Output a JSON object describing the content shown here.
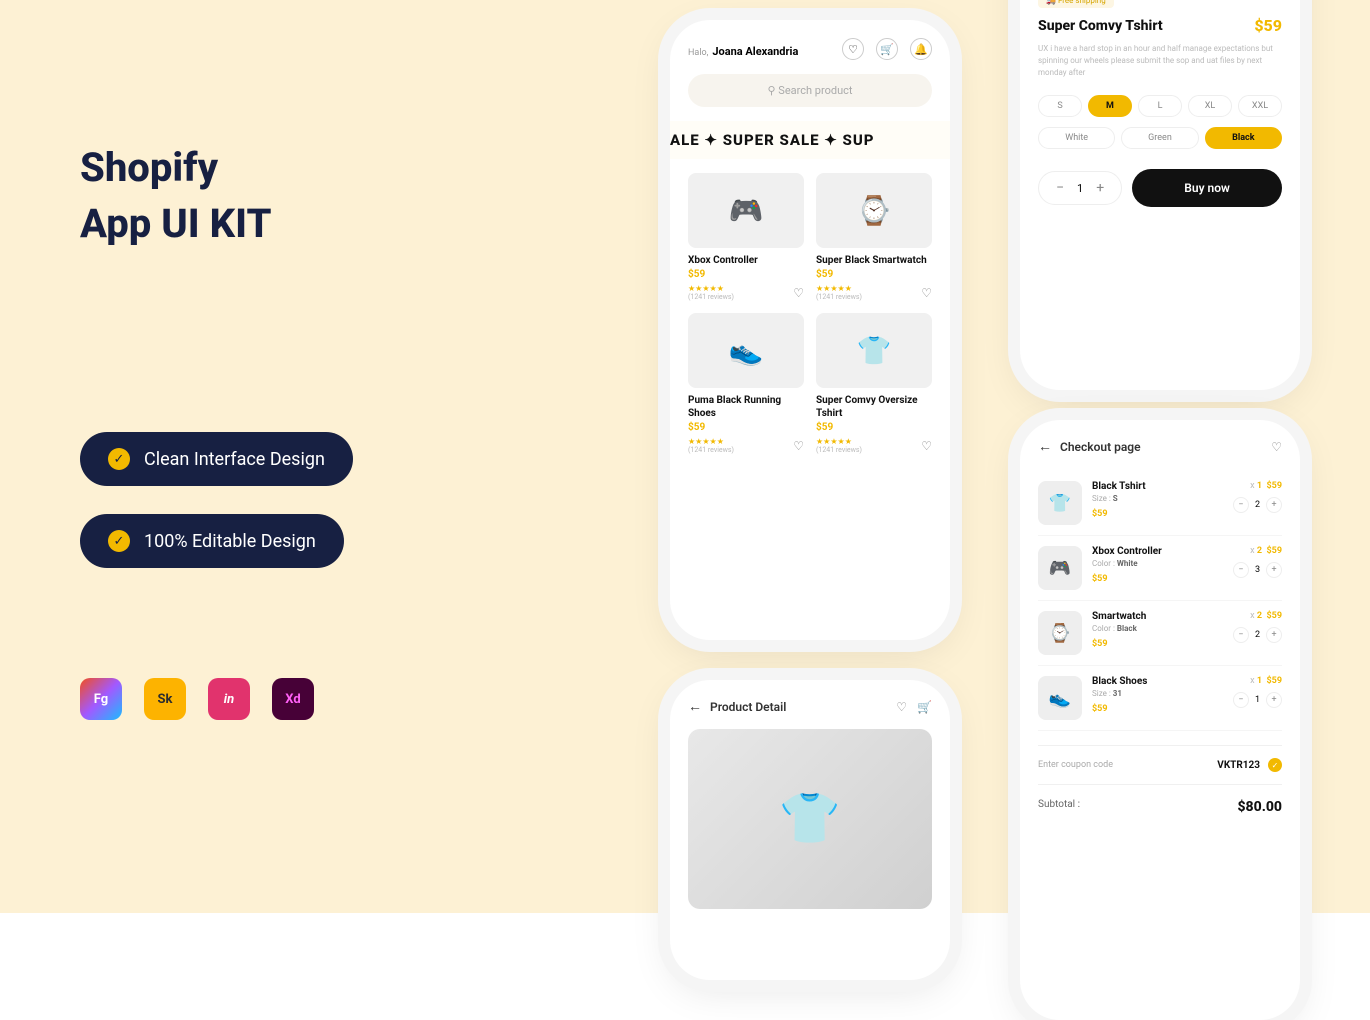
{
  "hero": {
    "title_line1": "Shopify",
    "title_line2": "App UI KIT"
  },
  "badges": [
    {
      "label": "Clean Interface Design"
    },
    {
      "label": "100% Editable Design"
    }
  ],
  "tools": [
    "Fg",
    "Sk",
    "in",
    "Xd"
  ],
  "home": {
    "greeting_prefix": "Halo,",
    "greeting_name": "Joana Alexandria",
    "search_placeholder": "Search product",
    "banner": "ALE ✦ SUPER SALE ✦ SUP",
    "products": [
      {
        "name": "Xbox Controller",
        "price": "$59",
        "reviews": "(1241 reviews)",
        "emoji": "🎮"
      },
      {
        "name": "Super Black Smartwatch",
        "price": "$59",
        "reviews": "(1241 reviews)",
        "emoji": "⌚"
      },
      {
        "name": "Puma Black Running Shoes",
        "price": "$59",
        "reviews": "(1241 reviews)",
        "emoji": "👟"
      },
      {
        "name": "Super Comvy Oversize Tshirt",
        "price": "$59",
        "reviews": "(1241 reviews)",
        "emoji": "👕"
      }
    ],
    "stars": "★★★★★"
  },
  "detail": {
    "free_ship": "Free shipping",
    "title": "Super Comvy Tshirt",
    "price": "$59",
    "desc": "UX i have a hard stop in an hour and half manage expectations but spinning our wheels please submit the sop and uat files by next monday after",
    "sizes": [
      "S",
      "M",
      "L",
      "XL",
      "XXL"
    ],
    "size_active": "M",
    "colors": [
      "White",
      "Green",
      "Black"
    ],
    "color_active": "Black",
    "qty": "1",
    "buy": "Buy now"
  },
  "checkout": {
    "title": "Checkout page",
    "items": [
      {
        "name": "Black Tshirt",
        "attr_label": "Size :",
        "attr_val": "S",
        "price": "$59",
        "qty": "1",
        "line_price": "$59",
        "emoji": "👕",
        "step": "2"
      },
      {
        "name": "Xbox Controller",
        "attr_label": "Color :",
        "attr_val": "White",
        "price": "$59",
        "qty": "2",
        "line_price": "$59",
        "emoji": "🎮",
        "step": "3"
      },
      {
        "name": "Smartwatch",
        "attr_label": "Color :",
        "attr_val": "Black",
        "price": "$59",
        "qty": "2",
        "line_price": "$59",
        "emoji": "⌚",
        "step": "2"
      },
      {
        "name": "Black Shoes",
        "attr_label": "Size :",
        "attr_val": "31",
        "price": "$59",
        "qty": "1",
        "line_price": "$59",
        "emoji": "👟",
        "step": "1"
      }
    ],
    "coupon_label": "Enter coupon code",
    "coupon_value": "VKTR123",
    "subtotal_label": "Subtotal :",
    "subtotal_value": "$80.00"
  },
  "pdetail": {
    "title": "Product Detail"
  }
}
